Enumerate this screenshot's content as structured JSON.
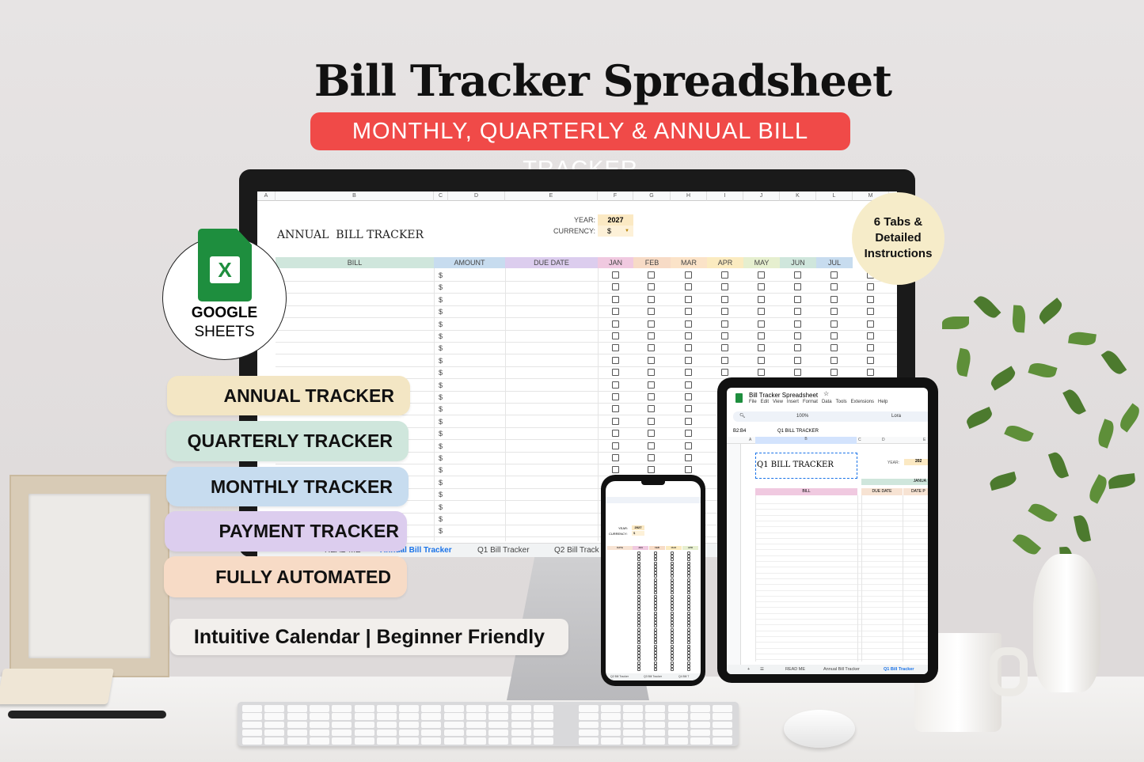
{
  "title": "Bill Tracker Spreadsheet",
  "subtitle": "MONTHLY, QUARTERLY & ANNUAL BILL TRACKER",
  "colors": {
    "accent_red": "#f04a48",
    "annual": "#f3e6c4",
    "quarterly": "#cfe6dc",
    "monthly": "#c7dcef",
    "payment": "#dccdee",
    "automated": "#f7dbc6",
    "badge": "#f6ecc9",
    "sheets_green": "#1e8e3e"
  },
  "google_sheets": {
    "line1": "GOOGLE",
    "line2": "SHEETS",
    "icon": "spreadsheet-file-icon"
  },
  "badge": {
    "lines": [
      "6 Tabs &",
      "Detailed",
      "Instructions"
    ]
  },
  "features": [
    "ANNUAL TRACKER",
    "QUARTERLY TRACKER",
    "MONTHLY TRACKER",
    "PAYMENT TRACKER",
    "FULLY AUTOMATED"
  ],
  "tagline": "Intuitive Calendar | Beginner Friendly",
  "desktop_sheet": {
    "columns": [
      "A",
      "B",
      "C",
      "D",
      "E",
      "F",
      "G",
      "H",
      "I",
      "J",
      "K",
      "L",
      "M"
    ],
    "heading": "ANNUAL  BILL TRACKER",
    "year_label": "YEAR:",
    "year_value": "2027",
    "currency_label": "CURRENCY:",
    "currency_value": "$",
    "headers": [
      "BILL",
      "AMOUNT",
      "DUE DATE",
      "JAN",
      "FEB",
      "MAR",
      "APR",
      "MAY",
      "JUN",
      "JUL"
    ],
    "currency_symbol": "$",
    "tabs": [
      "READ ME",
      "Annual Bill Tracker",
      "Q1 Bill Tracker",
      "Q2 Bill Track"
    ],
    "active_tab": "Annual Bill Tracker"
  },
  "tablet_sheet": {
    "doc_title": "Bill Tracker Spreadsheet",
    "menu": [
      "File",
      "Edit",
      "View",
      "Insert",
      "Format",
      "Data",
      "Tools",
      "Extensions",
      "Help"
    ],
    "zoom": "100%",
    "font": "Lora",
    "cell_ref": "B2:B4",
    "formula": "Q1 BILL TRACKER",
    "columns": [
      "A",
      "B",
      "C",
      "D",
      "E"
    ],
    "heading": "Q1 BILL TRACKER",
    "year_label": "YEAR:",
    "year_value": "202",
    "month": "JANUA",
    "headers": [
      "BILL",
      "DUE DATE",
      "DATE P"
    ],
    "tabs": [
      "READ ME",
      "Annual Bill Tracker",
      "Q1 Bill Tracker"
    ],
    "active_tab": "Q1 Bill Tracker"
  },
  "phone_sheet": {
    "year_label": "YEAR:",
    "year_value": "2027",
    "currency_label": "CURRENCY:",
    "currency_value": "$",
    "headers": [
      "DATE",
      "JAN",
      "FEB",
      "MAR",
      "APR"
    ],
    "tabs": [
      "Q2 Bill Tracker",
      "Q3 Bill Tracker",
      "Q4 Bill T"
    ]
  }
}
